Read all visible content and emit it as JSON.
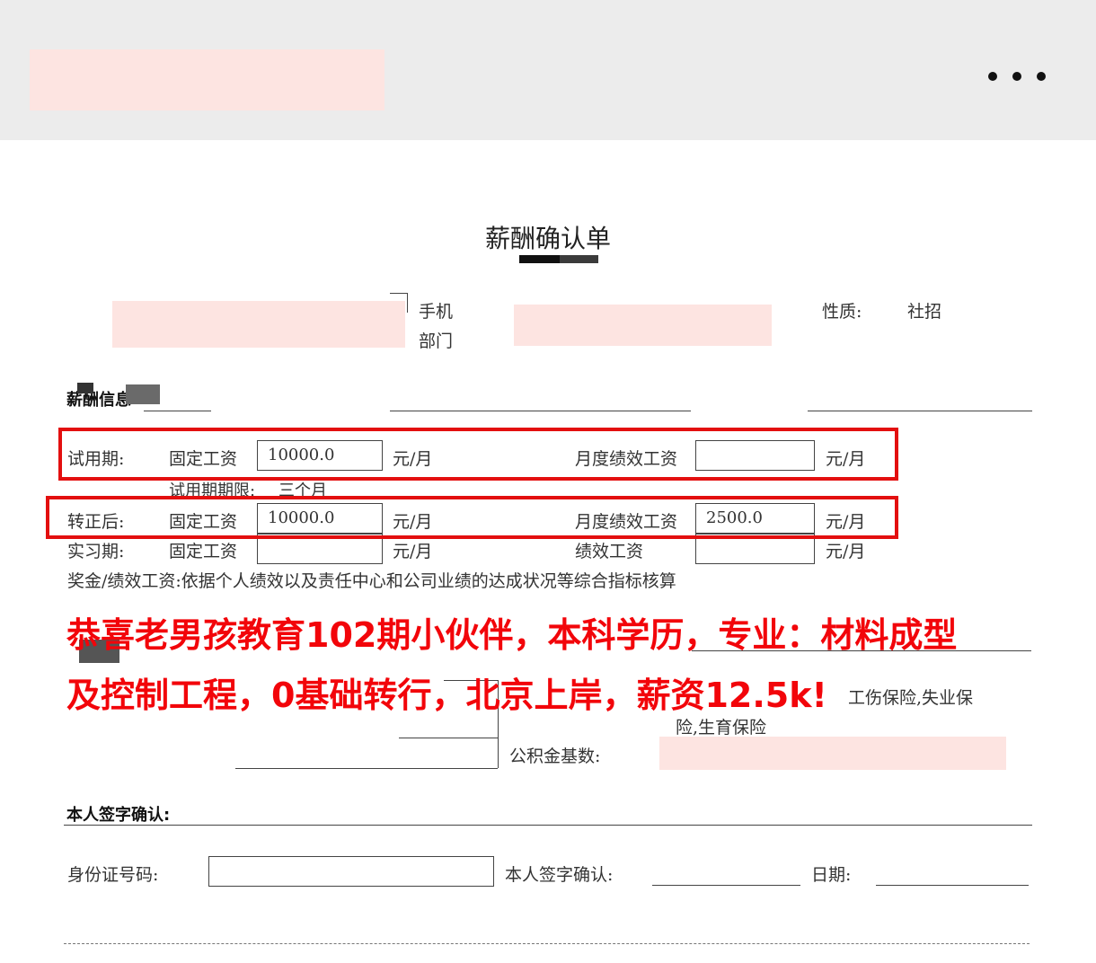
{
  "document": {
    "title": "薪酬确认单",
    "header": {
      "phone_label": "手机",
      "dept_label": "部门",
      "nature_label": "性质:",
      "nature_value": "社招"
    },
    "salary_section": {
      "title": "薪酬信息",
      "probation": {
        "label": "试用期:",
        "fixed_label": "固定工资",
        "fixed_value": "10000.0",
        "unit": "元/月",
        "perf_label": "月度绩效工资",
        "perf_value": "",
        "perf_unit": "元/月",
        "term_label": "试用期期限:",
        "term_value": "三个月"
      },
      "regular": {
        "label": "转正后:",
        "fixed_label": "固定工资",
        "fixed_value": "10000.0",
        "unit": "元/月",
        "perf_label": "月度绩效工资",
        "perf_value": "2500.0",
        "perf_unit": "元/月"
      },
      "intern": {
        "label": "实习期:",
        "fixed_label": "固定工资",
        "fixed_value": "",
        "unit": "元/月",
        "perf_label": "绩效工资",
        "perf_value": "",
        "perf_unit": "元/月"
      },
      "bonus_note": "奖金/绩效工资:依据个人绩效以及责任中心和公司业绩的达成状况等综合指标核算"
    },
    "banner": {
      "line1": "恭喜老男孩教育102期小伙伴，本科学历，专业：材料成型",
      "line2": "及控制工程，0基础转行，北京上岸，薪资12.5k!"
    },
    "welfare_section": {
      "insurance_line1": "工伤保险,失业保",
      "insurance_line2": "险,生育保险",
      "fund_label": "公积金基数:"
    },
    "signature_section": {
      "title": "本人签字确认:",
      "id_label": "身份证号码:",
      "sign_label": "本人签字确认:",
      "date_label": "日期:"
    }
  },
  "colors": {
    "highlight_frame": "#e30f0f",
    "banner_text": "#f2050a",
    "redaction": "#fde4e1"
  },
  "icons": {
    "more": "more-horizontal-icon"
  }
}
